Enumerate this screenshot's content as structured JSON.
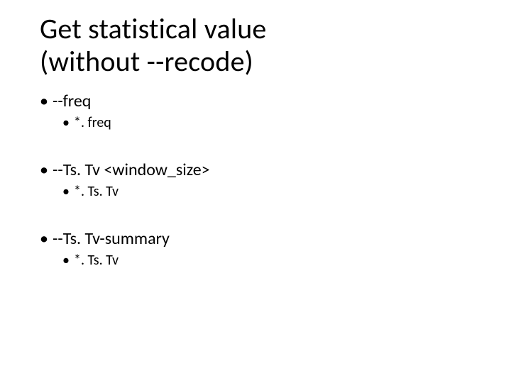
{
  "title_line1": "Get statistical value",
  "title_line2": "(without --recode)",
  "bullets": [
    {
      "main": "--freq",
      "sub": "*. freq"
    },
    {
      "main": "--Ts. Tv <window_size>",
      "sub": " *. Ts. Tv"
    },
    {
      "main": "--Ts. Tv-summary",
      "sub": "*. Ts. Tv"
    }
  ]
}
